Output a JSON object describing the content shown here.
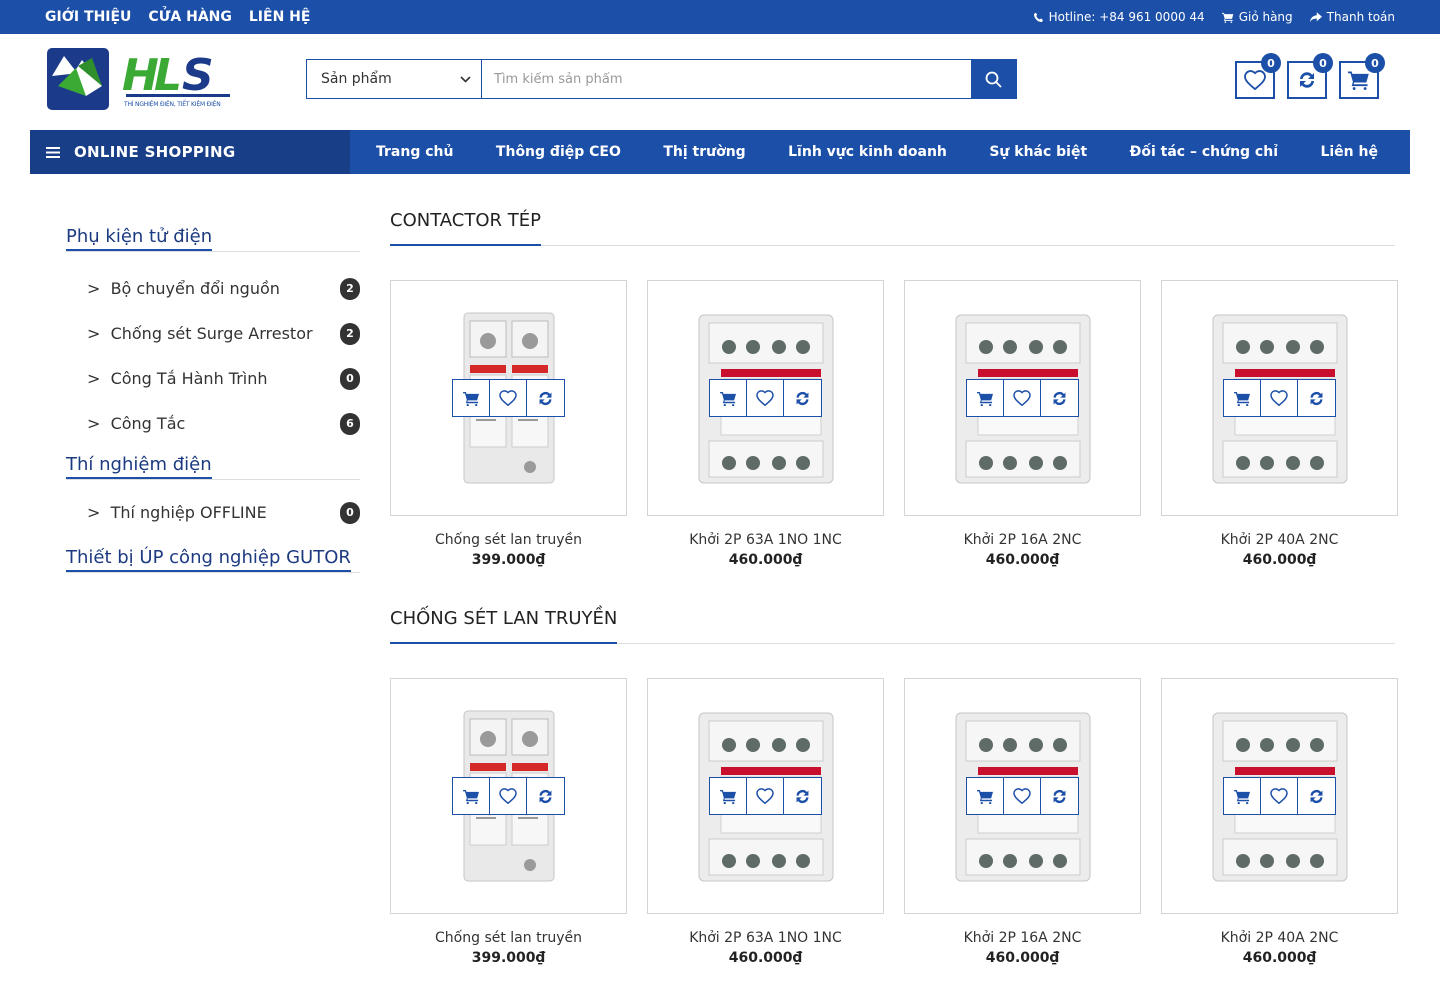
{
  "topbar": {
    "links": [
      "GIỚI THIỆU",
      "CỬA HÀNG",
      "LIÊN HỆ"
    ],
    "hotline": "Hotline: +84 961 0000 44",
    "cart": "Giỏ hàng",
    "checkout": "Thanh toán"
  },
  "logo": {
    "tagline": "THÍ NGHIỆM ĐIỆN, TIẾT KIỆM ĐIỆN"
  },
  "search": {
    "category": "Sản phẩm",
    "placeholder": "Tìm kiếm sản phẩm"
  },
  "header_icons": {
    "wishlist_count": "0",
    "compare_count": "0",
    "cart_count": "0"
  },
  "mainnav": {
    "online_shopping": "ONLINE SHOPPING",
    "items": [
      "Trang chủ",
      "Thông điệp CEO",
      "Thị trường",
      "Lĩnh vực kinh doanh",
      "Sự khác biệt",
      "Đối tác – chứng chỉ",
      "Liên hệ"
    ]
  },
  "sidebar": {
    "categories": [
      {
        "title": "Phụ kiện tử điện",
        "items": [
          {
            "label": "Bộ chuyển đổi nguồn",
            "count": "2"
          },
          {
            "label": "Chống sét Surge Arrestor",
            "count": "2"
          },
          {
            "label": "Công Tắ Hành Trình",
            "count": "0"
          },
          {
            "label": "Công Tắc",
            "count": "6"
          }
        ]
      },
      {
        "title": "Thí nghiệm điện",
        "items": [
          {
            "label": "Thí nghiệp OFFLINE",
            "count": "0"
          }
        ]
      },
      {
        "title": "Thiết bị ÚP công nghiệp GUTOR",
        "items": []
      }
    ]
  },
  "sections": [
    {
      "title": "CONTACTOR TÉP",
      "products": [
        {
          "name": "Chống sét lan truyền",
          "price": "399.000₫",
          "kind": "surge"
        },
        {
          "name": "Khởi 2P 63A 1NO 1NC",
          "price": "460.000₫",
          "kind": "contactor"
        },
        {
          "name": "Khởi 2P 16A 2NC",
          "price": "460.000₫",
          "kind": "contactor"
        },
        {
          "name": "Khởi 2P 40A 2NC",
          "price": "460.000₫",
          "kind": "contactor"
        }
      ]
    },
    {
      "title": "CHỐNG SÉT LAN TRUYỀN",
      "products": [
        {
          "name": "Chống sét lan truyền",
          "price": "399.000₫",
          "kind": "surge"
        },
        {
          "name": "Khởi 2P 63A 1NO 1NC",
          "price": "460.000₫",
          "kind": "contactor"
        },
        {
          "name": "Khởi 2P 16A 2NC",
          "price": "460.000₫",
          "kind": "contactor"
        },
        {
          "name": "Khởi 2P 40A 2NC",
          "price": "460.000₫",
          "kind": "contactor"
        }
      ]
    }
  ],
  "colors": {
    "brand_blue": "#1c4fa8",
    "logo_green": "#3aaa35"
  }
}
